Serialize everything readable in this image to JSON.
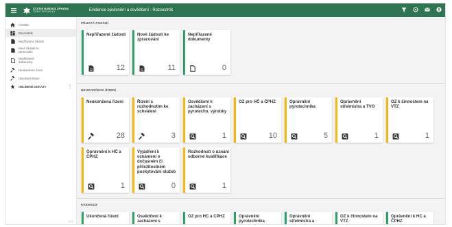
{
  "header": {
    "brand_line1": "STÁTNÍ BÁŇSKÁ SPRÁVA",
    "brand_line2": "ČESKÉ REPUBLIKY",
    "title": "Evidence oprávnění a osvědčení - Rozcestník",
    "accent": "#2f7553"
  },
  "sidebar": {
    "items": [
      {
        "label": "AISSBS",
        "icon": "home-icon"
      },
      {
        "label": "Rozcestník",
        "icon": "dashboard-icon"
      },
      {
        "label": "Nepřiřazené žádosti",
        "icon": "document-filled-icon"
      },
      {
        "label_l1": "Nové žádosti ke",
        "label_l2": "zpracování",
        "icon": "document-filled-icon"
      },
      {
        "label_l1": "Nepřiřazené",
        "label_l2": "dokumenty",
        "icon": "document-outline-icon"
      },
      {
        "label": "Neukončená řízení",
        "icon": "gavel-icon"
      },
      {
        "label": "Ukončená řízení",
        "icon": "gavel-icon"
      },
      {
        "label": "OBLÍBENÉ ODKAZY",
        "icon": "star-icon"
      }
    ],
    "fav_more": "⋮",
    "version": "1.0.4"
  },
  "sections": {
    "prijata": "PŘIJATÁ PODÁNÍ",
    "neukoncena": "NEUKONČENÁ ŘÍZENÍ",
    "evidence": "EVIDENCE"
  },
  "prijata_cards": [
    {
      "title": "Nepřiřazené žádosti",
      "count": "12",
      "icon": "document-filled-icon"
    },
    {
      "title": "Nové žádosti ke zpracování",
      "count": "11",
      "icon": "document-filled-icon"
    },
    {
      "title": "Nepřiřazené dokumenty",
      "count": "0",
      "icon": "document-outline-icon"
    }
  ],
  "neukoncena_cards": [
    {
      "title": "Neukončená řízení",
      "count": "28",
      "icon": "gavel-icon"
    },
    {
      "title": "Řízení s rozhodnutím ke schválení",
      "count": "3",
      "icon": "gavel-icon"
    },
    {
      "title": "Osvědčení k zacházení s pyrotechn. výrobky",
      "count": "1",
      "icon": "search-doc-icon"
    },
    {
      "title": "OZ pro HČ a ČPHZ",
      "count": "10",
      "icon": "search-doc-icon"
    },
    {
      "title": "Oprávnění pyrotechnika",
      "count": "5",
      "icon": "search-doc-icon"
    },
    {
      "title": "Oprávnění střelmistra a TVO",
      "count": "1",
      "icon": "search-doc-icon"
    },
    {
      "title": "OZ k činnostem na VTZ",
      "count": "1",
      "icon": "search-doc-icon"
    },
    {
      "title": "Oprávnění k HČ a ČPHZ",
      "count": "1",
      "icon": "search-doc-icon"
    },
    {
      "title": "Vyjádření k oznámení o dočasném či příležitostném poskytování služeb",
      "count": "0",
      "icon": "search-doc-icon"
    },
    {
      "title": "Rozhodnutí o uznání odborné kvalifikace",
      "count": "1",
      "icon": "search-doc-icon"
    }
  ],
  "evidence_cards": [
    {
      "title": "Ukončená řízení"
    },
    {
      "title": "Osvědčení k zacházení s"
    },
    {
      "title": "OZ pro HČ a ČPHZ"
    },
    {
      "title": "Oprávnění pyrotechnika"
    },
    {
      "title": "Oprávnění střelmistra a"
    },
    {
      "title": "OZ k činnostem na VTZ"
    },
    {
      "title": "Oprávnění k HČ a ČPHZ"
    }
  ]
}
